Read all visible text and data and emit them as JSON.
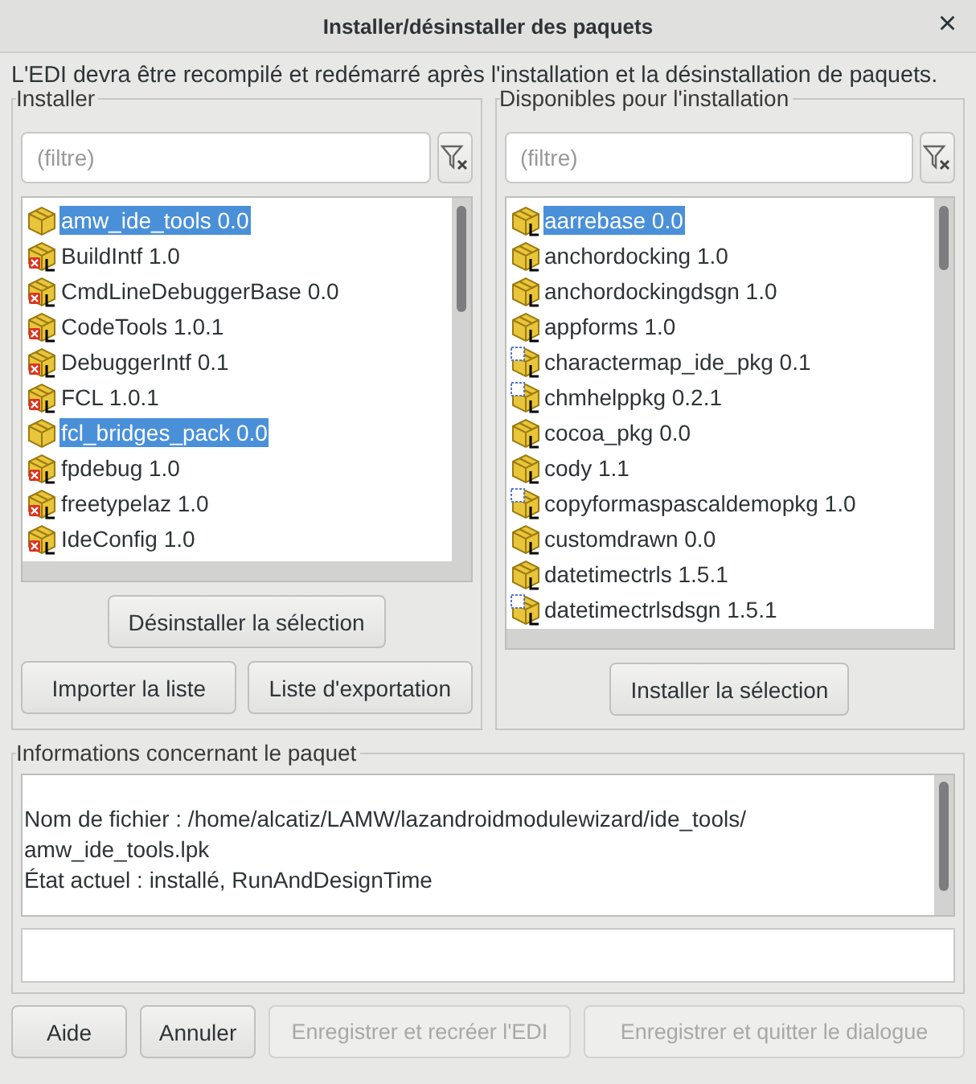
{
  "window": {
    "title": "Installer/désinstaller des paquets",
    "close": "×"
  },
  "notice": "L'EDI devra être recompilé et redémarré après l'installation et la désinstallation de paquets.",
  "install_group": {
    "title": "Installer",
    "filter": {
      "placeholder": "(filtre)"
    },
    "items": [
      {
        "label": "amw_ide_tools 0.0",
        "kind": "plain",
        "selected": true
      },
      {
        "label": "BuildIntf 1.0",
        "kind": "base",
        "selected": false
      },
      {
        "label": "CmdLineDebuggerBase 0.0",
        "kind": "base",
        "selected": false
      },
      {
        "label": "CodeTools 1.0.1",
        "kind": "base",
        "selected": false
      },
      {
        "label": "DebuggerIntf 0.1",
        "kind": "base",
        "selected": false
      },
      {
        "label": "FCL 1.0.1",
        "kind": "base",
        "selected": false
      },
      {
        "label": "fcl_bridges_pack 0.0",
        "kind": "plain",
        "selected": true
      },
      {
        "label": "fpdebug 1.0",
        "kind": "base",
        "selected": false
      },
      {
        "label": "freetypelaz 1.0",
        "kind": "base",
        "selected": false
      },
      {
        "label": "IdeConfig 1.0",
        "kind": "base",
        "selected": false
      }
    ],
    "uninstall_button": "Désinstaller la sélection",
    "import_button": "Importer la liste",
    "export_button": "Liste d'exportation"
  },
  "available_group": {
    "title": "Disponibles pour l'installation",
    "filter": {
      "placeholder": "(filtre)"
    },
    "items": [
      {
        "label": "aarrebase 0.0",
        "kind": "lazarus",
        "selected": true
      },
      {
        "label": "anchordocking 1.0",
        "kind": "lazarus",
        "selected": false
      },
      {
        "label": "anchordockingdsgn 1.0",
        "kind": "lazarus",
        "selected": false
      },
      {
        "label": "appforms 1.0",
        "kind": "lazarus",
        "selected": false
      },
      {
        "label": "charactermap_ide_pkg 0.1",
        "kind": "design",
        "selected": false
      },
      {
        "label": "chmhelppkg 0.2.1",
        "kind": "design",
        "selected": false
      },
      {
        "label": "cocoa_pkg 0.0",
        "kind": "lazarus",
        "selected": false
      },
      {
        "label": "cody 1.1",
        "kind": "lazarus",
        "selected": false
      },
      {
        "label": "copyformaspascaldemopkg 1.0",
        "kind": "design",
        "selected": false
      },
      {
        "label": "customdrawn 0.0",
        "kind": "lazarus",
        "selected": false
      },
      {
        "label": "datetimectrls 1.5.1",
        "kind": "lazarus",
        "selected": false
      },
      {
        "label": "datetimectrlsdsgn 1.5.1",
        "kind": "design",
        "selected": false
      }
    ],
    "install_button": "Installer la sélection"
  },
  "info_group": {
    "title": "Informations concernant le paquet",
    "lines": [
      "Nom de fichier : /home/alcatiz/LAMW/lazandroidmodulewizard/ide_tools/",
      "amw_ide_tools.lpk",
      "État actuel : installé, RunAndDesignTime"
    ]
  },
  "buttons": [
    {
      "label": "Aide",
      "disabled": false
    },
    {
      "label": "Annuler",
      "disabled": false
    },
    {
      "label": "Enregistrer et recréer l'EDI",
      "disabled": true
    },
    {
      "label": "Enregistrer et quitter le dialogue",
      "disabled": true
    }
  ]
}
